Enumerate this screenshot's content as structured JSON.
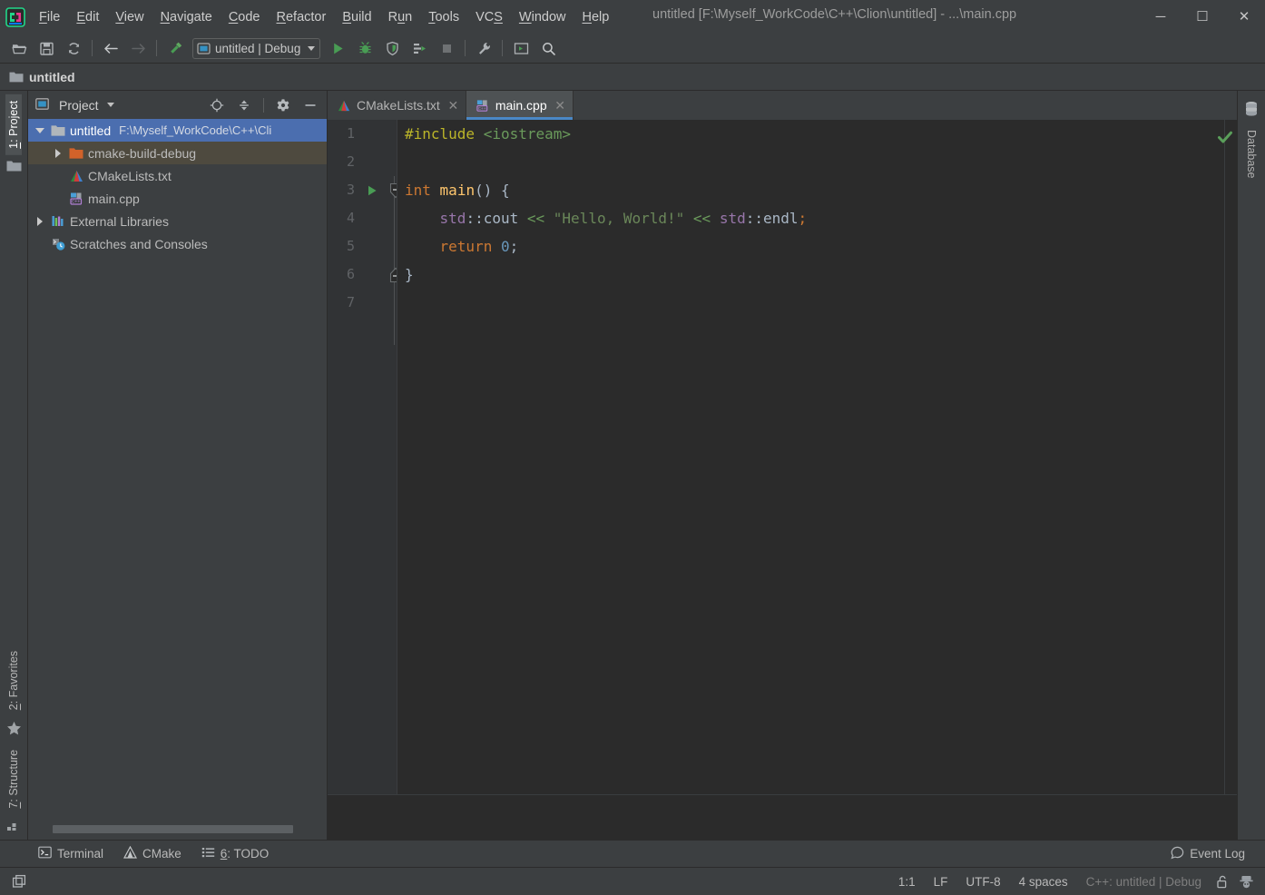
{
  "window": {
    "title": "untitled [F:\\Myself_WorkCode\\C++\\Clion\\untitled] - ...\\main.cpp",
    "minimize": "─",
    "maximize": "☐",
    "close": "✕",
    "app_icon": "clion-logo-icon"
  },
  "menubar": {
    "items": [
      {
        "label": "File",
        "mnemonic": "F"
      },
      {
        "label": "Edit",
        "mnemonic": "E"
      },
      {
        "label": "View",
        "mnemonic": "V"
      },
      {
        "label": "Navigate",
        "mnemonic": "N"
      },
      {
        "label": "Code",
        "mnemonic": "C"
      },
      {
        "label": "Refactor",
        "mnemonic": "R"
      },
      {
        "label": "Build",
        "mnemonic": "B"
      },
      {
        "label": "Run",
        "mnemonic": "u"
      },
      {
        "label": "Tools",
        "mnemonic": "T"
      },
      {
        "label": "VCS",
        "mnemonic": "S"
      },
      {
        "label": "Window",
        "mnemonic": "W"
      },
      {
        "label": "Help",
        "mnemonic": "H"
      }
    ]
  },
  "toolbar": {
    "buttons": [
      {
        "name": "open-folder-icon",
        "tooltip": "Open"
      },
      {
        "name": "save-all-icon",
        "tooltip": "Save All"
      },
      {
        "name": "sync-refresh-icon",
        "tooltip": "Synchronize"
      },
      {
        "name": "navigate-back-icon",
        "tooltip": "Back"
      },
      {
        "name": "navigate-forward-icon",
        "tooltip": "Forward"
      },
      {
        "name": "build-hammer-icon",
        "tooltip": "Build"
      },
      {
        "name": "run-icon",
        "tooltip": "Run"
      },
      {
        "name": "debug-icon",
        "tooltip": "Debug"
      },
      {
        "name": "run-with-coverage-icon",
        "tooltip": "Run with Coverage"
      },
      {
        "name": "profile-icon",
        "tooltip": "Profile"
      },
      {
        "name": "stop-icon",
        "tooltip": "Stop"
      },
      {
        "name": "settings-wrench-icon",
        "tooltip": "Settings"
      },
      {
        "name": "terminal-window-icon",
        "tooltip": "Terminal"
      },
      {
        "name": "search-everywhere-icon",
        "tooltip": "Search Everywhere"
      }
    ],
    "run_config": {
      "label": "untitled | Debug",
      "icon": "run-config-icon"
    }
  },
  "navbar": {
    "crumb": "untitled",
    "icon": "folder-icon"
  },
  "left_rail": {
    "top": [
      {
        "label": "1: Project",
        "mnemonic": "1",
        "active": true
      }
    ],
    "bottom": [
      {
        "label": "2: Favorites",
        "mnemonic": "2",
        "active": false
      },
      {
        "label": "7: Structure",
        "mnemonic": "7",
        "active": false
      }
    ]
  },
  "right_rail": {
    "tabs": [
      {
        "label": "Database",
        "icon": "database-icon"
      }
    ]
  },
  "project_panel": {
    "title": "Project",
    "header_icons": [
      {
        "name": "select-opened-file-icon"
      },
      {
        "name": "collapse-all-icon"
      },
      {
        "name": "gear-icon"
      },
      {
        "name": "hide-icon"
      }
    ],
    "tree": [
      {
        "label": "untitled",
        "path": "F:\\Myself_WorkCode\\C++\\Cli",
        "icon": "project-folder-icon",
        "twisty": "down",
        "indent": 0,
        "state": "selected"
      },
      {
        "label": "cmake-build-debug",
        "path": "",
        "icon": "excluded-folder-icon",
        "twisty": "right",
        "indent": 1,
        "state": "hover"
      },
      {
        "label": "CMakeLists.txt",
        "path": "",
        "icon": "cmake-file-icon",
        "twisty": "none",
        "indent": 1,
        "state": "normal"
      },
      {
        "label": "main.cpp",
        "path": "",
        "icon": "cpp-file-icon",
        "twisty": "none",
        "indent": 1,
        "state": "normal"
      },
      {
        "label": "External Libraries",
        "path": "",
        "icon": "libraries-icon",
        "twisty": "right",
        "indent": 0,
        "state": "normal"
      },
      {
        "label": "Scratches and Consoles",
        "path": "",
        "icon": "scratches-icon",
        "twisty": "none",
        "indent": 0,
        "state": "normal"
      }
    ]
  },
  "editor": {
    "tabs": [
      {
        "label": "CMakeLists.txt",
        "icon": "cmake-file-icon",
        "active": false,
        "close": "✕"
      },
      {
        "label": "main.cpp",
        "icon": "cpp-file-icon",
        "active": true,
        "close": "✕"
      }
    ],
    "inspection_status": "ok",
    "line_numbers": [
      "1",
      "2",
      "3",
      "4",
      "5",
      "6",
      "7"
    ],
    "gutter_run_marker_line": 3,
    "fold_lines": [
      3,
      6
    ],
    "code_lines": [
      {
        "n": 1,
        "tokens": [
          {
            "t": "#include",
            "c": "c-pre"
          },
          {
            "t": " ",
            "c": "c-plain"
          },
          {
            "t": "<iostream>",
            "c": "c-inc"
          }
        ]
      },
      {
        "n": 2,
        "tokens": []
      },
      {
        "n": 3,
        "tokens": [
          {
            "t": "int",
            "c": "c-kw"
          },
          {
            "t": " ",
            "c": "c-plain"
          },
          {
            "t": "main",
            "c": "c-fn"
          },
          {
            "t": "() {",
            "c": "c-punct"
          }
        ]
      },
      {
        "n": 4,
        "tokens": [
          {
            "t": "    ",
            "c": "c-plain"
          },
          {
            "t": "std",
            "c": "c-ns"
          },
          {
            "t": "::",
            "c": "c-op"
          },
          {
            "t": "cout",
            "c": "c-plain"
          },
          {
            "t": " ",
            "c": "c-plain"
          },
          {
            "t": "<<",
            "c": "c-inc"
          },
          {
            "t": " ",
            "c": "c-plain"
          },
          {
            "t": "\"Hello, World!\"",
            "c": "c-str"
          },
          {
            "t": " ",
            "c": "c-plain"
          },
          {
            "t": "<<",
            "c": "c-inc"
          },
          {
            "t": " ",
            "c": "c-plain"
          },
          {
            "t": "std",
            "c": "c-ns"
          },
          {
            "t": "::",
            "c": "c-op"
          },
          {
            "t": "endl",
            "c": "c-plain"
          },
          {
            "t": ";",
            "c": "c-kw"
          }
        ]
      },
      {
        "n": 5,
        "tokens": [
          {
            "t": "    ",
            "c": "c-plain"
          },
          {
            "t": "return",
            "c": "c-kw"
          },
          {
            "t": " ",
            "c": "c-plain"
          },
          {
            "t": "0",
            "c": "c-num"
          },
          {
            "t": ";",
            "c": "c-punct"
          }
        ]
      },
      {
        "n": 6,
        "tokens": [
          {
            "t": "}",
            "c": "c-punct"
          }
        ]
      },
      {
        "n": 7,
        "tokens": []
      }
    ]
  },
  "tool_windows": {
    "buttons": [
      {
        "label": "Terminal",
        "mnemonic": "",
        "icon": "terminal-icon"
      },
      {
        "label": "CMake",
        "mnemonic": "",
        "icon": "cmake-icon"
      },
      {
        "label": "6: TODO",
        "mnemonic": "6",
        "icon": "todo-list-icon"
      }
    ],
    "event_log": {
      "label": "Event Log",
      "icon": "event-log-icon"
    }
  },
  "statusbar": {
    "caret": "1:1",
    "line_separator": "LF",
    "encoding": "UTF-8",
    "indent": "4 spaces",
    "config": "C++: untitled | Debug",
    "lock_icon": "unlocked-icon",
    "inspector_icon": "hector-inspector-icon",
    "left_icon": "toggle-tool-windows-icon"
  },
  "colors": {
    "accent_blue": "#4b6eaf",
    "tab_underline": "#4a88c7",
    "green": "#499c54",
    "panel_bg": "#3c3f41",
    "editor_bg": "#2b2b2b",
    "gutter_bg": "#313335"
  }
}
